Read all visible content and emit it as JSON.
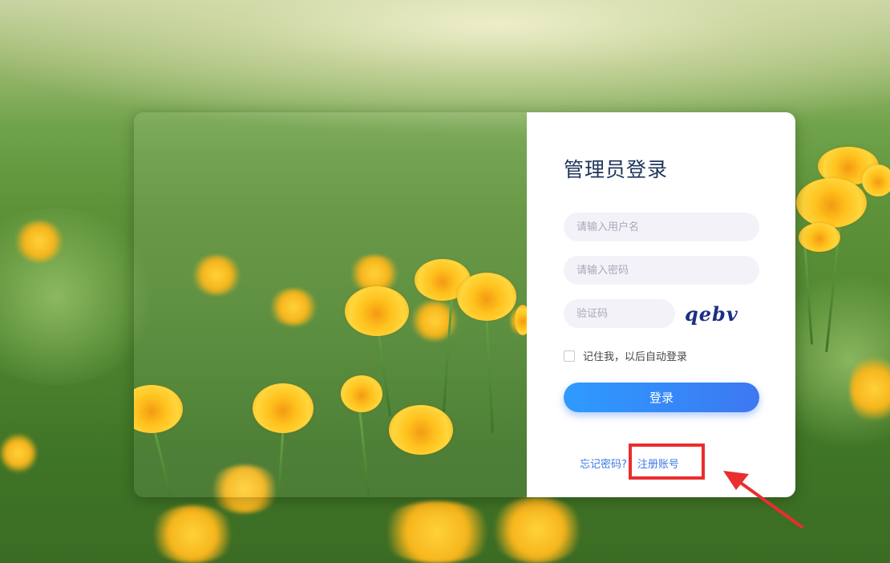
{
  "login": {
    "title": "管理员登录",
    "username_placeholder": "请输入用户名",
    "password_placeholder": "请输入密码",
    "captcha_placeholder": "验证码",
    "captcha_code": "qebv",
    "remember_label": "记住我，以后自动登录",
    "submit_label": "登录",
    "forgot_label": "忘记密码?",
    "register_label": "注册账号"
  },
  "colors": {
    "accent": "#3d8bff",
    "title": "#20355c",
    "link": "#3c78e6",
    "highlight": "#ea2d2d"
  },
  "icons": {
    "annotation_arrow": "red-arrow-icon"
  }
}
